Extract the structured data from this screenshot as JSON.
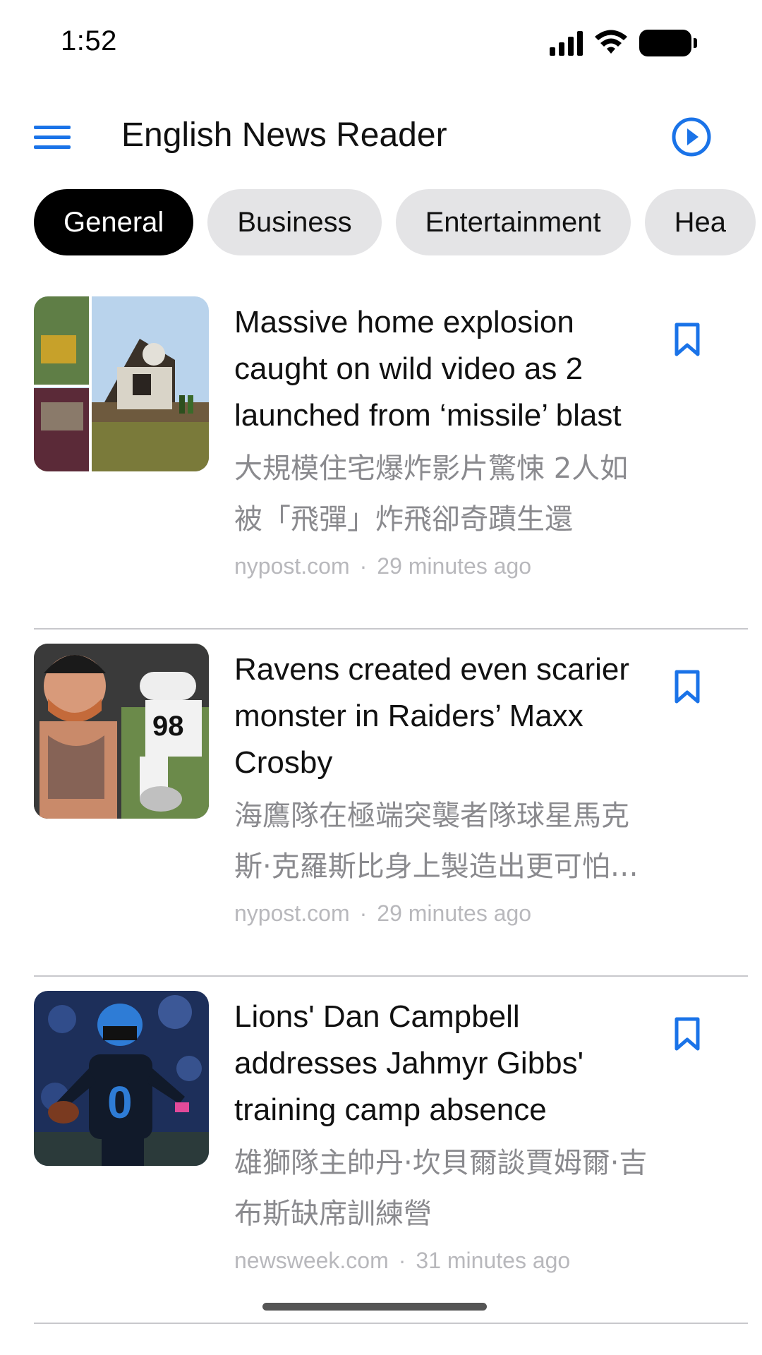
{
  "status_bar": {
    "time": "1:52",
    "icons": [
      "cellular-signal-icon",
      "wifi-icon",
      "battery-icon"
    ]
  },
  "app_bar": {
    "title": "English News Reader",
    "menu_icon": "hamburger-menu-icon",
    "play_icon": "play-circle-icon"
  },
  "colors": {
    "accent": "#1a73e8",
    "chip_active_bg": "#000000",
    "chip_bg": "#e4e4e6",
    "secondary_text": "#8a8a8e",
    "meta_text": "#b8b8bc"
  },
  "categories": [
    {
      "label": "General",
      "active": true
    },
    {
      "label": "Business",
      "active": false
    },
    {
      "label": "Entertainment",
      "active": false
    },
    {
      "label": "Hea",
      "active": false
    }
  ],
  "articles": [
    {
      "headline": "Massive home explosion caught on wild video as 2 launched from ‘missile’ blast",
      "translation": "大規模住宅爆炸影片驚悚 2人如被「飛彈」炸飛卻奇蹟生還",
      "source": "nypost.com",
      "time_ago": "29 minutes ago",
      "bookmark_icon": "bookmark-icon"
    },
    {
      "headline": "Ravens created even scarier monster in Raiders’ Maxx Crosby",
      "translation": "海鷹隊在極端突襲者隊球星馬克斯·克羅斯比身上製造出更可怕的怪物",
      "source": "nypost.com",
      "time_ago": "29 minutes ago",
      "bookmark_icon": "bookmark-icon"
    },
    {
      "headline": "Lions' Dan Campbell addresses Jahmyr Gibbs' training camp absence",
      "translation": "雄獅隊主帥丹·坎貝爾談賈姆爾·吉布斯缺席訓練營",
      "source": "newsweek.com",
      "time_ago": "31 minutes ago",
      "bookmark_icon": "bookmark-icon"
    }
  ]
}
